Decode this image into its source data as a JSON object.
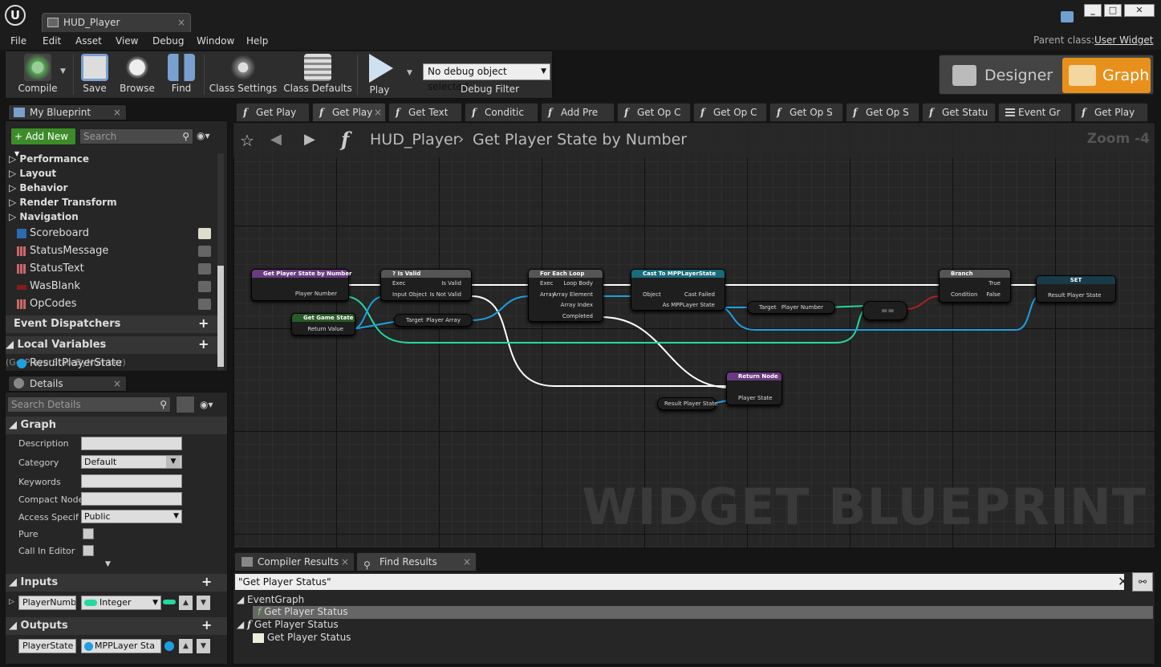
{
  "window": {
    "tab_title": "HUD_Player",
    "logo": "ue-logo-icon",
    "controls": [
      "minimize",
      "maximize",
      "close"
    ]
  },
  "menu": [
    "File",
    "Edit",
    "Asset",
    "View",
    "Debug",
    "Window",
    "Help"
  ],
  "parent_class": {
    "label": "Parent class:",
    "value": "User Widget"
  },
  "toolbar": {
    "compile": "Compile",
    "save": "Save",
    "browse": "Browse",
    "find": "Find",
    "class_settings": "Class Settings",
    "class_defaults": "Class Defaults",
    "play": "Play",
    "debug_select": "No debug object selected",
    "debug_label": "Debug Filter"
  },
  "modes": {
    "designer": "Designer",
    "graph": "Graph"
  },
  "my_blueprint": {
    "title": "My Blueprint",
    "add_new": "Add New",
    "search_placeholder": "Search",
    "categories": [
      "Performance",
      "Layout",
      "Behavior",
      "Render Transform",
      "Navigation"
    ],
    "widgets": [
      "Scoreboard",
      "StatusMessage",
      "StatusText",
      "WasBlank",
      "OpCodes"
    ],
    "event_dispatchers": "Event Dispatchers",
    "local_vars": "Local Variables",
    "local_vars_hint": "(GetPlayerStateByNumber)",
    "local_var_item": "ResultPlayerState"
  },
  "details": {
    "title": "Details",
    "search_placeholder": "Search Details",
    "graph_section": "Graph",
    "fields": {
      "description": "Description",
      "category": "Category",
      "category_val": "Default",
      "keywords": "Keywords",
      "compact": "Compact Node",
      "access": "Access Specif",
      "access_val": "Public",
      "pure": "Pure",
      "call_in_editor": "Call In Editor"
    },
    "inputs": "Inputs",
    "input_name": "PlayerNumb",
    "input_type": "Integer",
    "outputs": "Outputs",
    "output_name": "PlayerState",
    "output_type": "MPPLayer Sta"
  },
  "graph_tabs": [
    "Get Play",
    "Get Play",
    "Get Text",
    "Conditic",
    "Add Pre",
    "Get Op C",
    "Get Op C",
    "Get Op S",
    "Get Op S",
    "Get Statu",
    "Event Gr",
    "Get Play"
  ],
  "breadcrumb": {
    "blueprint": "HUD_Player",
    "function": "Get Player State by Number"
  },
  "zoom": "Zoom -4",
  "watermark": "WIDGET BLUEPRINT",
  "nodes": {
    "entry": {
      "title": "Get Player State by Number",
      "pin": "Player Number"
    },
    "isvalid": {
      "title": "? Is Valid",
      "exec": "Exec",
      "input": "Input Object",
      "valid": "Is Valid",
      "notvalid": "Is Not Valid"
    },
    "getgamestate": {
      "title": "Get Game State",
      "out": "Return Value"
    },
    "playerarray": {
      "target": "Target",
      "out": "Player Array"
    },
    "foreach": {
      "title": "For Each Loop",
      "exec": "Exec",
      "array": "Array",
      "body": "Loop Body",
      "elem": "Array Element",
      "index": "Array Index",
      "completed": "Completed"
    },
    "cast": {
      "title": "Cast To MPPLayerState",
      "object": "Object",
      "failed": "Cast Failed",
      "as": "As MPPLayer State"
    },
    "getnum": {
      "target": "Target",
      "out": "Player Number"
    },
    "eq": {
      "label": "=="
    },
    "branch": {
      "title": "Branch",
      "cond": "Condition",
      "true": "True",
      "false": "False"
    },
    "set": {
      "title": "SET",
      "pin": "Result Player State"
    },
    "ret": {
      "title": "Return Node",
      "pin": "Player State"
    },
    "resultget": {
      "label": "Result Player State"
    }
  },
  "bottom_tabs": [
    "Compiler Results",
    "Find Results"
  ],
  "find": {
    "query": "\"Get Player Status\"",
    "results": [
      {
        "text": "EventGraph"
      },
      {
        "text": "Get Player Status"
      },
      {
        "text": "Get Player Status"
      },
      {
        "text": "Get Player Status"
      }
    ]
  },
  "colors": {
    "accent": "#e8901c",
    "exec": "#ffffff",
    "object": "#1ea0e0",
    "integer": "#22d9a0",
    "bool": "#b02020",
    "function": "#4a2860",
    "pure": "#2a5a2a"
  }
}
